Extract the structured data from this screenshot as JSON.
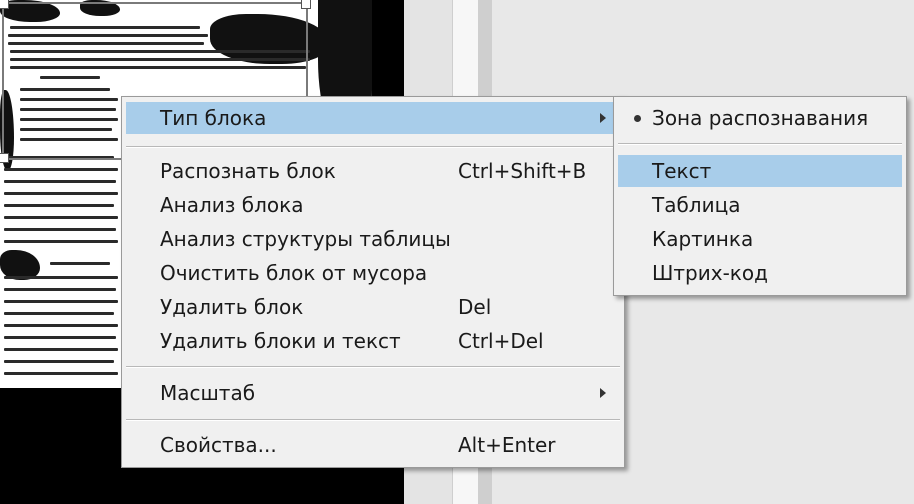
{
  "context_menu": {
    "items": [
      {
        "label": "Тип блока",
        "shortcut": "",
        "submenu": true
      },
      {
        "label": "Распознать блок",
        "shortcut": "Ctrl+Shift+B"
      },
      {
        "label": "Анализ блока",
        "shortcut": ""
      },
      {
        "label": "Анализ структуры таблицы",
        "shortcut": ""
      },
      {
        "label": "Очистить блок от мусора",
        "shortcut": ""
      },
      {
        "label": "Удалить блок",
        "shortcut": "Del"
      },
      {
        "label": "Удалить блоки и текст",
        "shortcut": "Ctrl+Del"
      },
      {
        "label": "Масштаб",
        "shortcut": "",
        "submenu": true
      },
      {
        "label": "Свойства...",
        "shortcut": "Alt+Enter"
      }
    ]
  },
  "block_type_submenu": {
    "items": [
      {
        "label": "Зона распознавания",
        "checked": true
      },
      {
        "label": "Текст",
        "highlighted": true
      },
      {
        "label": "Таблица"
      },
      {
        "label": "Картинка"
      },
      {
        "label": "Штрих-код"
      }
    ]
  },
  "colors": {
    "menu_background": "#f0f0f0",
    "highlight": "#a8cdea",
    "text": "#1a1a1a"
  }
}
